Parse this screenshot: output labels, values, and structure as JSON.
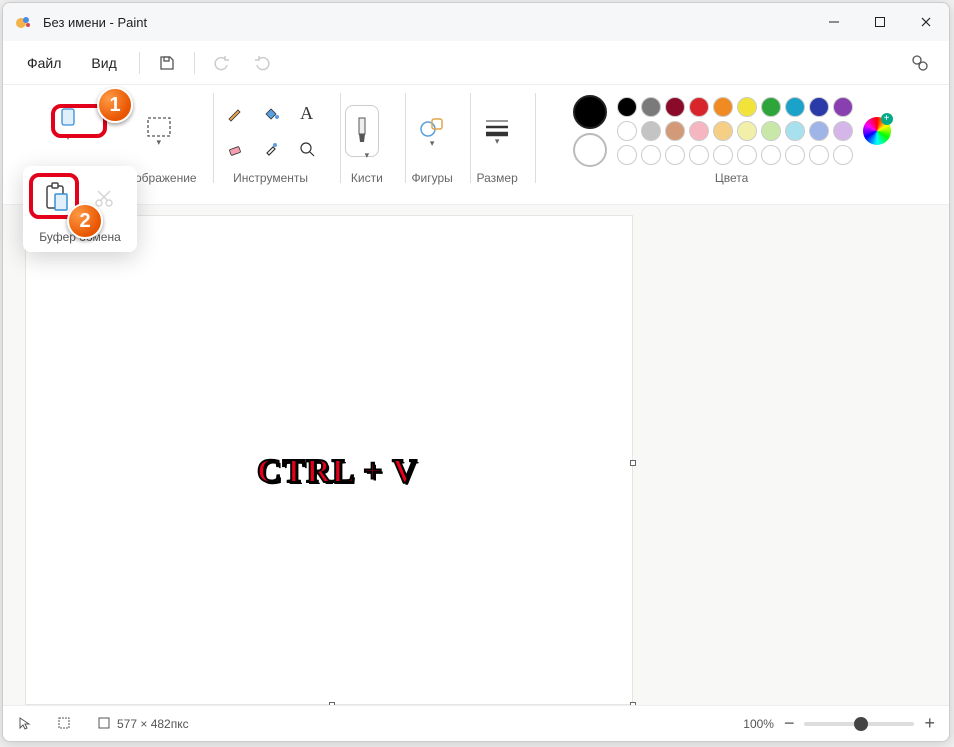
{
  "titlebar": {
    "title": "Без имени - Paint"
  },
  "menu": {
    "file": "Файл",
    "view": "Вид"
  },
  "ribbon": {
    "image": "Изображение",
    "tools": "Инструменты",
    "brushes": "Кисти",
    "shapes": "Фигуры",
    "size": "Размер",
    "colors": "Цвета"
  },
  "dropdown": {
    "clipboard": "Буфер обмена"
  },
  "status": {
    "dimensions": "577 × 482пкс",
    "zoom": "100%"
  },
  "annotation": {
    "shortcut": "CTRL + V",
    "step1": "1",
    "step2": "2"
  },
  "palette_row1": [
    "#000000",
    "#7a7a7a",
    "#8a0b29",
    "#d8252c",
    "#f08b24",
    "#f2e33a",
    "#2ea53b",
    "#1aa2c9",
    "#2a3aa8",
    "#8a3fb0"
  ],
  "palette_row2": [
    "#ffffff",
    "#c4c4c4",
    "#d39a7a",
    "#f5b6c2",
    "#f6cf87",
    "#f2efa8",
    "#c8e8a8",
    "#a8e1ee",
    "#9fb5e8",
    "#d4b6e8"
  ]
}
